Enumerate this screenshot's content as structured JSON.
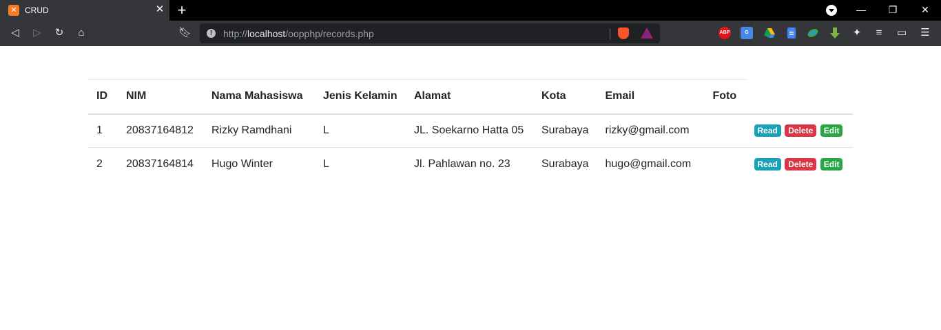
{
  "browser": {
    "tab_title": "CRUD",
    "tab_icon": "xampp-icon",
    "url_prefix": "http://",
    "url_host": "localhost",
    "url_path": "/oopphp/records.php",
    "colors": {
      "frame": "#000000",
      "toolbar": "#35363a",
      "omnibox": "#202124"
    },
    "extensions": [
      {
        "name": "adblock-plus-icon",
        "label": "ABP",
        "color": "#e2131c"
      },
      {
        "name": "google-translate-icon",
        "label": "",
        "color": "#4a86e8"
      },
      {
        "name": "google-drive-icon",
        "label": "",
        "color": "#fbbc04"
      },
      {
        "name": "google-docs-icon",
        "label": "",
        "color": "#4285f4"
      },
      {
        "name": "leaf-icon",
        "label": "",
        "color": "#34a853"
      },
      {
        "name": "download-icon",
        "label": "",
        "color": "#7cb342"
      }
    ]
  },
  "table": {
    "headers": [
      "ID",
      "NIM",
      "Nama Mahasiswa",
      "Jenis Kelamin",
      "Alamat",
      "Kota",
      "Email",
      "Foto"
    ],
    "rows": [
      {
        "id": "1",
        "nim": "20837164812",
        "nama": "Rizky Ramdhani",
        "jk": "L",
        "alamat": "JL. Soekarno Hatta 05",
        "kota": "Surabaya",
        "email": "rizky@gmail.com",
        "foto": ""
      },
      {
        "id": "2",
        "nim": "20837164814",
        "nama": "Hugo Winter",
        "jk": "L",
        "alamat": "Jl. Pahlawan no. 23",
        "kota": "Surabaya",
        "email": "hugo@gmail.com",
        "foto": ""
      }
    ],
    "actions": {
      "read": "Read",
      "delete": "Delete",
      "edit": "Edit"
    },
    "colors": {
      "read": "#17a2b8",
      "delete": "#dc3545",
      "edit": "#28a745"
    }
  }
}
